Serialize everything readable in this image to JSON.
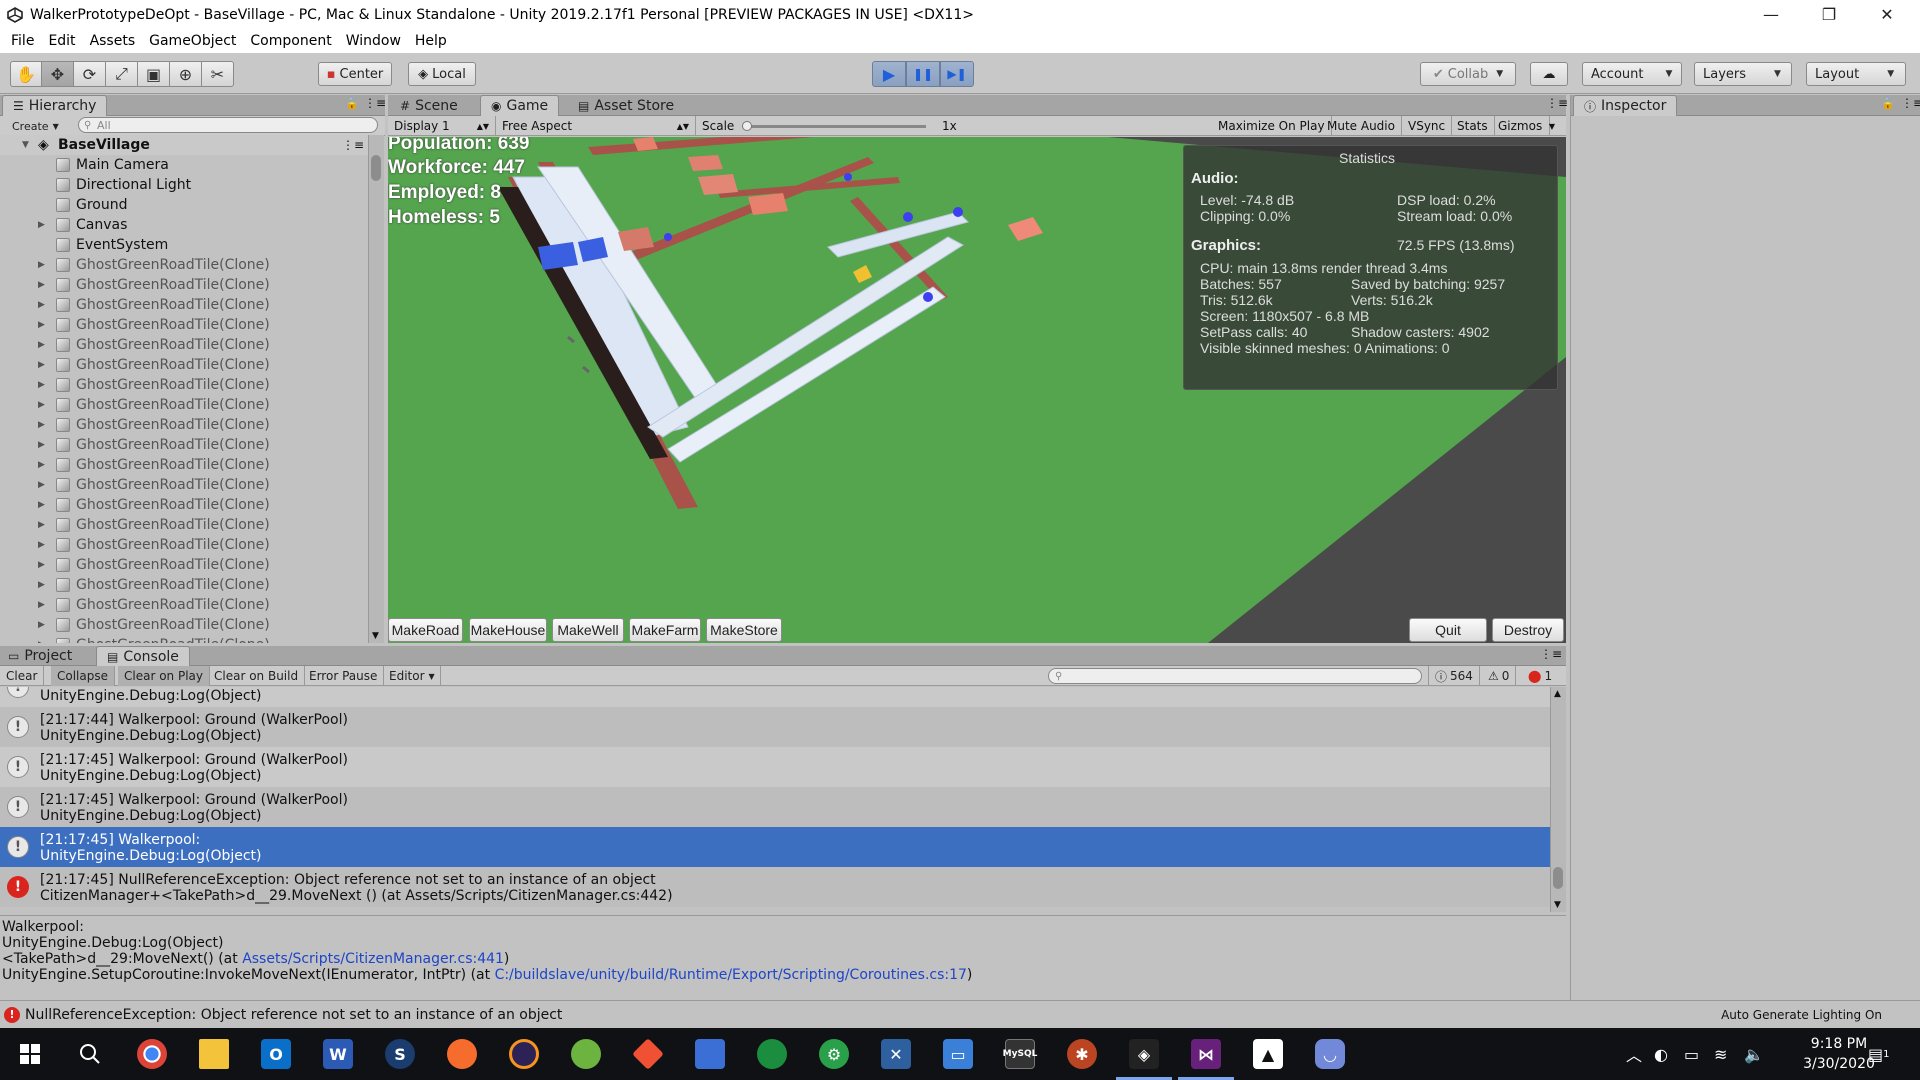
{
  "window": {
    "title": "WalkerPrototypeDeOpt - BaseVillage - PC, Mac & Linux Standalone - Unity 2019.2.17f1 Personal [PREVIEW PACKAGES IN USE] <DX11>",
    "minimize": "—",
    "restore": "❐",
    "close": "✕"
  },
  "menu": [
    "File",
    "Edit",
    "Assets",
    "GameObject",
    "Component",
    "Window",
    "Help"
  ],
  "toolbar": {
    "tools": [
      "✋",
      "✥",
      "⟳",
      "⤢",
      "▣",
      "⊕",
      "✂"
    ],
    "pivot": "Center",
    "space": "Local",
    "play": "▶",
    "pause": "❚❚",
    "step": "▶❚",
    "collab": "Collab",
    "cloud": "☁",
    "account": "Account",
    "layers": "Layers",
    "layout": "Layout"
  },
  "hierarchy": {
    "tab": "Hierarchy",
    "create": "Create",
    "search_placeholder": "All",
    "root": "BaseVillage",
    "items": [
      {
        "label": "Main Camera",
        "expandable": false
      },
      {
        "label": "Directional Light",
        "expandable": false
      },
      {
        "label": "Ground",
        "expandable": false
      },
      {
        "label": "Canvas",
        "expandable": true
      },
      {
        "label": "EventSystem",
        "expandable": false
      },
      {
        "label": "GhostGreenRoadTile(Clone)",
        "expandable": true
      },
      {
        "label": "GhostGreenRoadTile(Clone)",
        "expandable": true
      },
      {
        "label": "GhostGreenRoadTile(Clone)",
        "expandable": true
      },
      {
        "label": "GhostGreenRoadTile(Clone)",
        "expandable": true
      },
      {
        "label": "GhostGreenRoadTile(Clone)",
        "expandable": true
      },
      {
        "label": "GhostGreenRoadTile(Clone)",
        "expandable": true
      },
      {
        "label": "GhostGreenRoadTile(Clone)",
        "expandable": true
      },
      {
        "label": "GhostGreenRoadTile(Clone)",
        "expandable": true
      },
      {
        "label": "GhostGreenRoadTile(Clone)",
        "expandable": true
      },
      {
        "label": "GhostGreenRoadTile(Clone)",
        "expandable": true
      },
      {
        "label": "GhostGreenRoadTile(Clone)",
        "expandable": true
      },
      {
        "label": "GhostGreenRoadTile(Clone)",
        "expandable": true
      },
      {
        "label": "GhostGreenRoadTile(Clone)",
        "expandable": true
      },
      {
        "label": "GhostGreenRoadTile(Clone)",
        "expandable": true
      },
      {
        "label": "GhostGreenRoadTile(Clone)",
        "expandable": true
      },
      {
        "label": "GhostGreenRoadTile(Clone)",
        "expandable": true
      },
      {
        "label": "GhostGreenRoadTile(Clone)",
        "expandable": true
      },
      {
        "label": "GhostGreenRoadTile(Clone)",
        "expandable": true
      },
      {
        "label": "GhostGreenRoadTile(Clone)",
        "expandable": true
      },
      {
        "label": "GhostGreenRoadTile(Clone)",
        "expandable": true
      }
    ]
  },
  "views": {
    "scene_tab": "Scene",
    "game_tab": "Game",
    "asset_store_tab": "Asset Store",
    "display": "Display 1",
    "aspect": "Free Aspect",
    "scale_label": "Scale",
    "scale_value": "1x",
    "maximize": "Maximize On Play",
    "mute": "Mute Audio",
    "vsync": "VSync",
    "stats": "Stats",
    "gizmos": "Gizmos"
  },
  "game_hud": {
    "population": "Population: 639",
    "workforce": "Workforce:  447",
    "employed": "Employed:  8",
    "homeless": "Homeless:  5"
  },
  "statistics": {
    "title": "Statistics",
    "audio_header": "Audio:",
    "level": "Level: -74.8 dB",
    "clipping": "Clipping: 0.0%",
    "dsp_load": "DSP load: 0.2%",
    "stream_load": "Stream load: 0.0%",
    "graphics_header": "Graphics:",
    "fps": "72.5 FPS (13.8ms)",
    "cpu": "CPU: main 13.8ms  render thread 3.4ms",
    "batches": "Batches: 557",
    "saved_batching": "Saved by batching: 9257",
    "tris": "Tris: 512.6k",
    "verts": "Verts: 516.2k",
    "screen": "Screen: 1180x507 - 6.8 MB",
    "setpass": "SetPass calls: 40",
    "shadow_casters": "Shadow casters: 4902",
    "skinned": "Visible skinned meshes: 0  Animations: 0"
  },
  "game_buttons": {
    "make_road": "MakeRoad",
    "make_house": "MakeHouse",
    "make_well": "MakeWell",
    "make_farm": "MakeFarm",
    "make_store": "MakeStore",
    "quit": "Quit",
    "destroy": "Destroy"
  },
  "inspector": {
    "tab": "Inspector"
  },
  "console": {
    "project_tab": "Project",
    "console_tab": "Console",
    "clear": "Clear",
    "collapse": "Collapse",
    "clear_on_play": "Clear on Play",
    "clear_on_build": "Clear on Build",
    "error_pause": "Error Pause",
    "editor": "Editor",
    "log_count": "564",
    "warn_count": "0",
    "error_count": "1",
    "top_partial": "UnityEngine.Debug:Log(Object)",
    "logs": [
      {
        "line1": "[21:17:44] Walkerpool: Ground (WalkerPool)",
        "line2": "UnityEngine.Debug:Log(Object)",
        "type": "info"
      },
      {
        "line1": "[21:17:45] Walkerpool: Ground (WalkerPool)",
        "line2": "UnityEngine.Debug:Log(Object)",
        "type": "info"
      },
      {
        "line1": "[21:17:45] Walkerpool: Ground (WalkerPool)",
        "line2": "UnityEngine.Debug:Log(Object)",
        "type": "info"
      },
      {
        "line1": "[21:17:45] Walkerpool:",
        "line2": "UnityEngine.Debug:Log(Object)",
        "type": "info-selected"
      },
      {
        "line1": "[21:17:45] NullReferenceException: Object reference not set to an instance of an object",
        "line2": "CitizenManager+<TakePath>d__29.MoveNext () (at Assets/Scripts/CitizenManager.cs:442)",
        "type": "error"
      }
    ],
    "detail": {
      "l1": "Walkerpool:",
      "l2": "UnityEngine.Debug:Log(Object)",
      "l3_pre": "<TakePath>d__29:MoveNext() (at ",
      "l3_link": "Assets/Scripts/CitizenManager.cs:441",
      "l3_post": ")",
      "l4_pre": "UnityEngine.SetupCoroutine:InvokeMoveNext(IEnumerator, IntPtr) (at ",
      "l4_link": "C:/buildslave/unity/build/Runtime/Export/Scripting/Coroutines.cs:17",
      "l4_post": ")"
    }
  },
  "statusbar": {
    "error": "NullReferenceException: Object reference not set to an instance of an object",
    "lighting": "Auto Generate Lighting On"
  },
  "taskbar": {
    "time": "9:18 PM",
    "date": "3/30/2020",
    "notification_count": "1"
  },
  "colors": {
    "grass": "#54a54e",
    "road": "#a8524a",
    "house": "#e8806e",
    "selection": "#3d6fc1",
    "error": "#d9251d"
  }
}
